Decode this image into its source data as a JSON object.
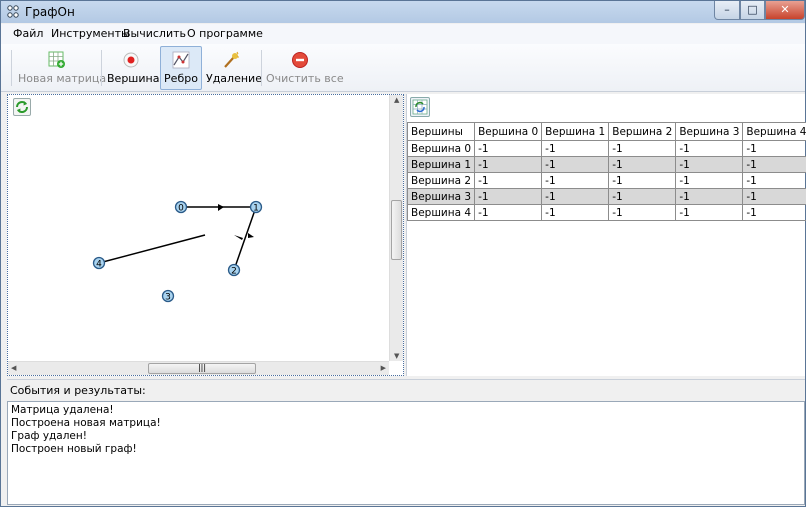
{
  "window": {
    "title": "ГрафОн",
    "min": "–",
    "max": "□",
    "close": "✕"
  },
  "menu": [
    "Файл",
    "Инструменты",
    "Вычислить",
    "О программе"
  ],
  "toolbar": {
    "new_matrix": "Новая матрица",
    "vertex": "Вершина",
    "edge": "Ребро",
    "delete": "Удаление",
    "clear_all": "Очистить все",
    "active": "Ребро"
  },
  "graph": {
    "vertices": [
      {
        "label": "0"
      },
      {
        "label": "1"
      },
      {
        "label": "2"
      },
      {
        "label": "3"
      },
      {
        "label": "4"
      }
    ],
    "node_color": "#a9d3ef"
  },
  "matrix": {
    "header": [
      "Вершины",
      "Вершина 0",
      "Вершина 1",
      "Вершина 2",
      "Вершина 3",
      "Вершина 4"
    ],
    "rows": [
      [
        "Вершина 0",
        "-1",
        "-1",
        "-1",
        "-1",
        "-1"
      ],
      [
        "Вершина 1",
        "-1",
        "-1",
        "-1",
        "-1",
        "-1"
      ],
      [
        "Вершина 2",
        "-1",
        "-1",
        "-1",
        "-1",
        "-1"
      ],
      [
        "Вершина 3",
        "-1",
        "-1",
        "-1",
        "-1",
        "-1"
      ],
      [
        "Вершина 4",
        "-1",
        "-1",
        "-1",
        "-1",
        "-1"
      ]
    ]
  },
  "events": {
    "label": "События и результаты:",
    "lines": [
      "Матрица удалена!",
      "Построена новая матрица!",
      "Граф удален!",
      "Построен новый граф!"
    ]
  },
  "scroll_thumb": "|||"
}
